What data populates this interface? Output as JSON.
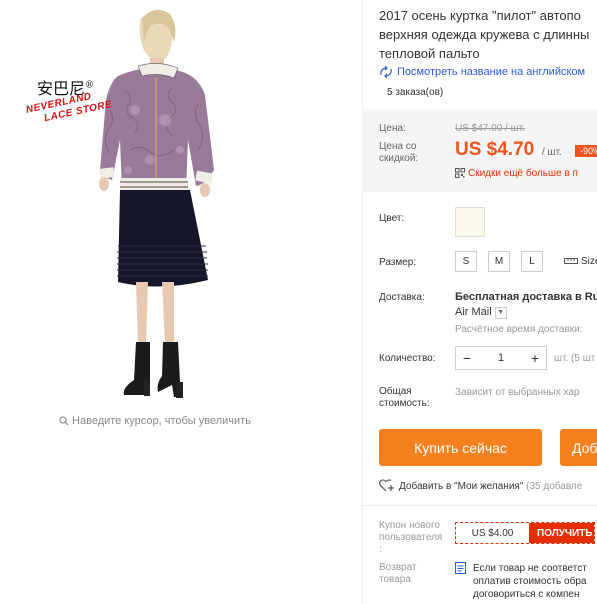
{
  "gallery": {
    "logo_text": "安巴尼",
    "logo_reg": "®",
    "store_line1": "NEVERLAND",
    "store_line2": "LACE STORE",
    "zoom_hint": "Наведите курсор, чтобы увеличить"
  },
  "product": {
    "title_lines": [
      "2017 осень куртка \"пилот\" автопо",
      "верхняя одежда кружева с длинны",
      "тепловой пальто"
    ],
    "translate_link": "Посмотреть название на английском",
    "orders": "5 заказа(ов)"
  },
  "price": {
    "label": "Цена:",
    "old": "US $47.00 / шт.",
    "discount_label_1": "Цена со",
    "discount_label_2": "скидкой:",
    "new": "US $4.70",
    "unit": "/ шт.",
    "discount_badge": "-90%",
    "more_discounts": "Скидки ещё больше в п"
  },
  "options": {
    "color_label": "Цвет:",
    "color_swatch": "#faf8e8",
    "size_label": "Размер:",
    "sizes": [
      "S",
      "M",
      "L"
    ],
    "size_guide": "Size"
  },
  "shipping": {
    "label": "Доставка:",
    "main": "Бесплатная доставка в Ru",
    "method": "Air Mail",
    "time": "Расчётное время доставки:"
  },
  "quantity": {
    "label": "Количество:",
    "minus": "−",
    "value": "1",
    "plus": "+",
    "unit_info": "шт. (5 шт"
  },
  "total": {
    "label_1": "Общая",
    "label_2": "стоимость:",
    "value": "Зависит от выбранных хар"
  },
  "actions": {
    "buy_now": "Купить сейчас",
    "add_to_cart": "Доб",
    "wishlist": "Добавить в \"Мои желания\"",
    "wishlist_count": "(35 добавле"
  },
  "coupon": {
    "label_1": "Купон нового",
    "label_2": "пользователя",
    "label_3": ":",
    "amount": "US $4.00",
    "get": "ПОЛУЧИТЬ"
  },
  "returns": {
    "label_1": "Возврат",
    "label_2": "товара",
    "line1": "Если товар не соответст",
    "line2": "оплатив стоимость обра",
    "line3": "договориться с компен"
  },
  "colors": {
    "accent_orange": "#f5811e",
    "price_red": "#f0541e",
    "coupon_red": "#e62e04",
    "link_blue": "#2a5bd7"
  }
}
